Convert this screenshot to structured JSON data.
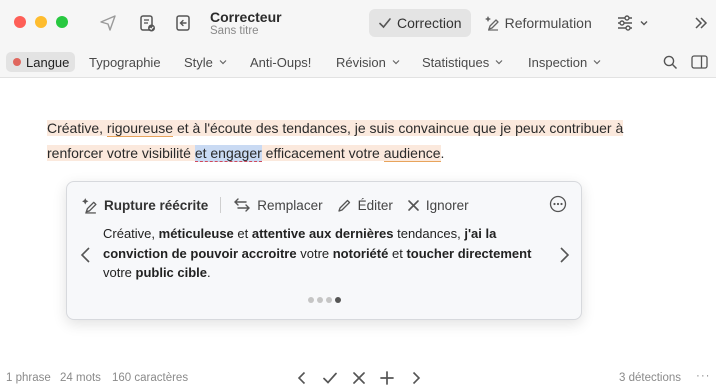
{
  "window": {
    "title": "Correcteur",
    "subtitle": "Sans titre"
  },
  "toolbar": {
    "modes": [
      {
        "label": "Correction",
        "icon": "checkmark-icon",
        "active": true
      },
      {
        "label": "Reformulation",
        "icon": "sparkle-pen-icon",
        "active": false
      }
    ]
  },
  "menu": {
    "language": "Langue",
    "items": [
      "Typographie",
      "Style",
      "Anti-Oups!",
      "Révision",
      "Statistiques",
      "Inspection"
    ]
  },
  "document": {
    "line1": {
      "p1": "Créative, ",
      "p2": "rigoureuse",
      "p3": " et à l'écoute des tendances, je suis convaincue que je peux contribuer à"
    },
    "line2": {
      "p1": "renforcer votre visibilité ",
      "p2": "et engager",
      "p3": " efficacement votre ",
      "p4": "audience",
      "p5": "."
    }
  },
  "suggestion": {
    "title": "Rupture réécrite",
    "actions": {
      "replace": "Remplacer",
      "edit": "Éditer",
      "ignore": "Ignorer"
    },
    "text": {
      "t1": "Créative, ",
      "t2": "méticuleuse",
      "t3": " et ",
      "t4": "attentive aux dernières",
      "t5": " tendances, ",
      "t6": "j'ai la conviction de pouvoir accroitre",
      "t7": " votre ",
      "t8": "notoriété",
      "t9": " et ",
      "t10": "toucher directement",
      "t11": " votre ",
      "t12": "public cible",
      "t13": "."
    },
    "page_index": 4,
    "page_count": 4
  },
  "status": {
    "sentences": "1 phrase",
    "words": "24 mots",
    "chars": "160 caractères",
    "detections": "3 détections",
    "more": "···"
  },
  "colors": {
    "accent_highlight": "#fbe9dd",
    "selection": "#c9daf3",
    "language_dot": "#e0675e",
    "underline_orange": "#e8a45c",
    "underline_red": "#d1495b"
  }
}
